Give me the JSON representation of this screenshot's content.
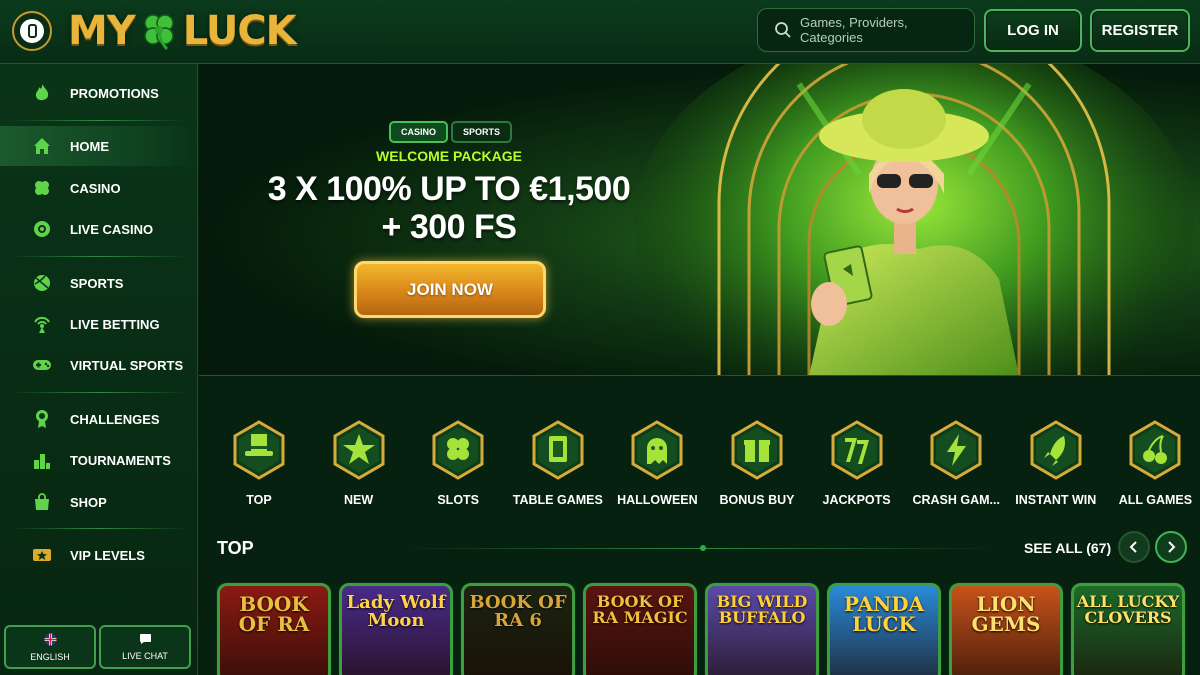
{
  "header": {
    "logo_left": "MY",
    "logo_right": "LUCK",
    "search_placeholder": "Games, Providers, Categories",
    "login_label": "LOG IN",
    "register_label": "REGISTER"
  },
  "sidebar": {
    "items": [
      {
        "label": "PROMOTIONS",
        "icon": "flame-icon"
      },
      {
        "label": "HOME",
        "icon": "home-icon",
        "active": true
      },
      {
        "label": "CASINO",
        "icon": "clover-icon"
      },
      {
        "label": "LIVE CASINO",
        "icon": "roulette-icon"
      },
      {
        "label": "SPORTS",
        "icon": "ball-icon"
      },
      {
        "label": "LIVE BETTING",
        "icon": "broadcast-icon"
      },
      {
        "label": "VIRTUAL SPORTS",
        "icon": "gamepad-icon"
      },
      {
        "label": "CHALLENGES",
        "icon": "medal-icon"
      },
      {
        "label": "TOURNAMENTS",
        "icon": "podium-icon"
      },
      {
        "label": "SHOP",
        "icon": "bag-icon"
      },
      {
        "label": "VIP LEVELS",
        "icon": "ticket-icon"
      }
    ],
    "language_label": "ENGLISH",
    "live_chat_label": "LIVE CHAT"
  },
  "hero": {
    "tab_casino": "CASINO",
    "tab_sports": "SPORTS",
    "welcome": "WELCOME PACKAGE",
    "headline_line1": "3 X 100% UP TO €1,500",
    "headline_line2": "+ 300 FS",
    "cta": "JOIN NOW"
  },
  "categories": [
    {
      "label": "TOP",
      "icon": "top-hat-icon"
    },
    {
      "label": "NEW",
      "icon": "star-icon"
    },
    {
      "label": "SLOTS",
      "icon": "clover-icon"
    },
    {
      "label": "TABLE GAMES",
      "icon": "card-icon"
    },
    {
      "label": "HALLOWEEN",
      "icon": "ghost-icon"
    },
    {
      "label": "BONUS BUY",
      "icon": "gift-icon"
    },
    {
      "label": "JACKPOTS",
      "icon": "sevens-icon"
    },
    {
      "label": "CRASH GAM...",
      "icon": "lightning-icon"
    },
    {
      "label": "INSTANT WIN",
      "icon": "rocket-icon"
    },
    {
      "label": "ALL GAMES",
      "icon": "cherries-icon"
    }
  ],
  "top_section": {
    "title": "TOP",
    "see_all": "SEE ALL (67)"
  },
  "games": [
    {
      "title": "BOOK OF RA",
      "bg": "#8a1a12",
      "fg": "#e8c040"
    },
    {
      "title": "Lady Wolf Moon",
      "bg": "#4a2b8a",
      "fg": "#ffd24a"
    },
    {
      "title": "BOOK OF RA 6",
      "bg": "#1b2410",
      "fg": "#d7a53a"
    },
    {
      "title": "BOOK OF RA MAGIC",
      "bg": "#5a1410",
      "fg": "#f0c040"
    },
    {
      "title": "BIG WILD BUFFALO",
      "bg": "#5a4aa8",
      "fg": "#ffcf3a"
    },
    {
      "title": "PANDA LUCK",
      "bg": "#2a8ad8",
      "fg": "#ffd23a"
    },
    {
      "title": "LION GEMS",
      "bg": "#c8521a",
      "fg": "#ffe070"
    },
    {
      "title": "ALL LUCKY CLOVERS",
      "bg": "#1c6a2a",
      "fg": "#ffe16a"
    }
  ]
}
